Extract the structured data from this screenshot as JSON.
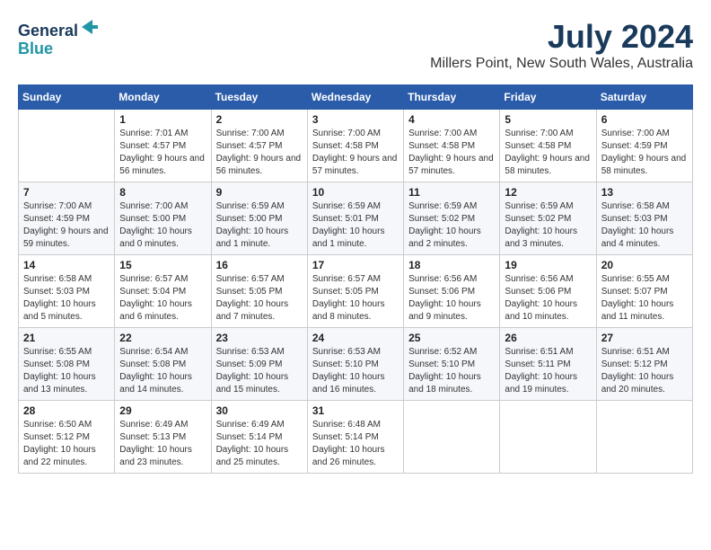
{
  "logo": {
    "line1": "General",
    "line2": "Blue",
    "arrow_color": "#2196a6"
  },
  "header": {
    "month_year": "July 2024",
    "location": "Millers Point, New South Wales, Australia"
  },
  "days_of_week": [
    "Sunday",
    "Monday",
    "Tuesday",
    "Wednesday",
    "Thursday",
    "Friday",
    "Saturday"
  ],
  "weeks": [
    [
      {
        "day": "",
        "sunrise": "",
        "sunset": "",
        "daylight": ""
      },
      {
        "day": "1",
        "sunrise": "Sunrise: 7:01 AM",
        "sunset": "Sunset: 4:57 PM",
        "daylight": "Daylight: 9 hours and 56 minutes."
      },
      {
        "day": "2",
        "sunrise": "Sunrise: 7:00 AM",
        "sunset": "Sunset: 4:57 PM",
        "daylight": "Daylight: 9 hours and 56 minutes."
      },
      {
        "day": "3",
        "sunrise": "Sunrise: 7:00 AM",
        "sunset": "Sunset: 4:58 PM",
        "daylight": "Daylight: 9 hours and 57 minutes."
      },
      {
        "day": "4",
        "sunrise": "Sunrise: 7:00 AM",
        "sunset": "Sunset: 4:58 PM",
        "daylight": "Daylight: 9 hours and 57 minutes."
      },
      {
        "day": "5",
        "sunrise": "Sunrise: 7:00 AM",
        "sunset": "Sunset: 4:58 PM",
        "daylight": "Daylight: 9 hours and 58 minutes."
      },
      {
        "day": "6",
        "sunrise": "Sunrise: 7:00 AM",
        "sunset": "Sunset: 4:59 PM",
        "daylight": "Daylight: 9 hours and 58 minutes."
      }
    ],
    [
      {
        "day": "7",
        "sunrise": "Sunrise: 7:00 AM",
        "sunset": "Sunset: 4:59 PM",
        "daylight": "Daylight: 9 hours and 59 minutes."
      },
      {
        "day": "8",
        "sunrise": "Sunrise: 7:00 AM",
        "sunset": "Sunset: 5:00 PM",
        "daylight": "Daylight: 10 hours and 0 minutes."
      },
      {
        "day": "9",
        "sunrise": "Sunrise: 6:59 AM",
        "sunset": "Sunset: 5:00 PM",
        "daylight": "Daylight: 10 hours and 1 minute."
      },
      {
        "day": "10",
        "sunrise": "Sunrise: 6:59 AM",
        "sunset": "Sunset: 5:01 PM",
        "daylight": "Daylight: 10 hours and 1 minute."
      },
      {
        "day": "11",
        "sunrise": "Sunrise: 6:59 AM",
        "sunset": "Sunset: 5:02 PM",
        "daylight": "Daylight: 10 hours and 2 minutes."
      },
      {
        "day": "12",
        "sunrise": "Sunrise: 6:59 AM",
        "sunset": "Sunset: 5:02 PM",
        "daylight": "Daylight: 10 hours and 3 minutes."
      },
      {
        "day": "13",
        "sunrise": "Sunrise: 6:58 AM",
        "sunset": "Sunset: 5:03 PM",
        "daylight": "Daylight: 10 hours and 4 minutes."
      }
    ],
    [
      {
        "day": "14",
        "sunrise": "Sunrise: 6:58 AM",
        "sunset": "Sunset: 5:03 PM",
        "daylight": "Daylight: 10 hours and 5 minutes."
      },
      {
        "day": "15",
        "sunrise": "Sunrise: 6:57 AM",
        "sunset": "Sunset: 5:04 PM",
        "daylight": "Daylight: 10 hours and 6 minutes."
      },
      {
        "day": "16",
        "sunrise": "Sunrise: 6:57 AM",
        "sunset": "Sunset: 5:05 PM",
        "daylight": "Daylight: 10 hours and 7 minutes."
      },
      {
        "day": "17",
        "sunrise": "Sunrise: 6:57 AM",
        "sunset": "Sunset: 5:05 PM",
        "daylight": "Daylight: 10 hours and 8 minutes."
      },
      {
        "day": "18",
        "sunrise": "Sunrise: 6:56 AM",
        "sunset": "Sunset: 5:06 PM",
        "daylight": "Daylight: 10 hours and 9 minutes."
      },
      {
        "day": "19",
        "sunrise": "Sunrise: 6:56 AM",
        "sunset": "Sunset: 5:06 PM",
        "daylight": "Daylight: 10 hours and 10 minutes."
      },
      {
        "day": "20",
        "sunrise": "Sunrise: 6:55 AM",
        "sunset": "Sunset: 5:07 PM",
        "daylight": "Daylight: 10 hours and 11 minutes."
      }
    ],
    [
      {
        "day": "21",
        "sunrise": "Sunrise: 6:55 AM",
        "sunset": "Sunset: 5:08 PM",
        "daylight": "Daylight: 10 hours and 13 minutes."
      },
      {
        "day": "22",
        "sunrise": "Sunrise: 6:54 AM",
        "sunset": "Sunset: 5:08 PM",
        "daylight": "Daylight: 10 hours and 14 minutes."
      },
      {
        "day": "23",
        "sunrise": "Sunrise: 6:53 AM",
        "sunset": "Sunset: 5:09 PM",
        "daylight": "Daylight: 10 hours and 15 minutes."
      },
      {
        "day": "24",
        "sunrise": "Sunrise: 6:53 AM",
        "sunset": "Sunset: 5:10 PM",
        "daylight": "Daylight: 10 hours and 16 minutes."
      },
      {
        "day": "25",
        "sunrise": "Sunrise: 6:52 AM",
        "sunset": "Sunset: 5:10 PM",
        "daylight": "Daylight: 10 hours and 18 minutes."
      },
      {
        "day": "26",
        "sunrise": "Sunrise: 6:51 AM",
        "sunset": "Sunset: 5:11 PM",
        "daylight": "Daylight: 10 hours and 19 minutes."
      },
      {
        "day": "27",
        "sunrise": "Sunrise: 6:51 AM",
        "sunset": "Sunset: 5:12 PM",
        "daylight": "Daylight: 10 hours and 20 minutes."
      }
    ],
    [
      {
        "day": "28",
        "sunrise": "Sunrise: 6:50 AM",
        "sunset": "Sunset: 5:12 PM",
        "daylight": "Daylight: 10 hours and 22 minutes."
      },
      {
        "day": "29",
        "sunrise": "Sunrise: 6:49 AM",
        "sunset": "Sunset: 5:13 PM",
        "daylight": "Daylight: 10 hours and 23 minutes."
      },
      {
        "day": "30",
        "sunrise": "Sunrise: 6:49 AM",
        "sunset": "Sunset: 5:14 PM",
        "daylight": "Daylight: 10 hours and 25 minutes."
      },
      {
        "day": "31",
        "sunrise": "Sunrise: 6:48 AM",
        "sunset": "Sunset: 5:14 PM",
        "daylight": "Daylight: 10 hours and 26 minutes."
      },
      {
        "day": "",
        "sunrise": "",
        "sunset": "",
        "daylight": ""
      },
      {
        "day": "",
        "sunrise": "",
        "sunset": "",
        "daylight": ""
      },
      {
        "day": "",
        "sunrise": "",
        "sunset": "",
        "daylight": ""
      }
    ]
  ]
}
